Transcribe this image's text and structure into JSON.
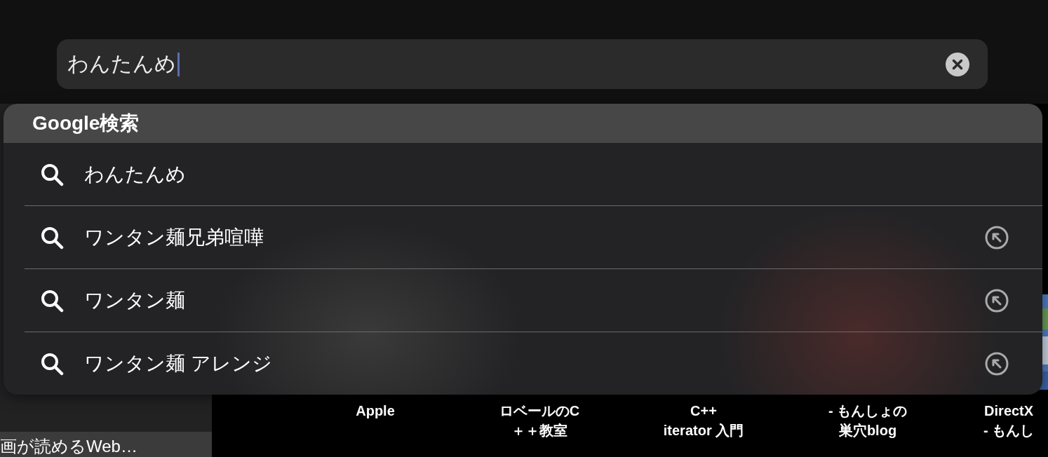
{
  "search": {
    "value": "わんたんめ"
  },
  "suggestions": {
    "title": "Google検索",
    "items": [
      {
        "text": "わんたんめ",
        "fill_button": false
      },
      {
        "text": "ワンタン麺兄弟喧嘩",
        "fill_button": true
      },
      {
        "text": "ワンタン麺",
        "fill_button": true
      },
      {
        "text": "ワンタン麺 アレンジ",
        "fill_button": true
      }
    ]
  },
  "sidebar": {
    "item": "画が読めるWeb…"
  },
  "bookmarks": [
    {
      "lines": [
        "Apple"
      ]
    },
    {
      "lines": [
        "ロベールのC",
        "＋＋教室"
      ]
    },
    {
      "lines": [
        "C++",
        "iterator 入門"
      ]
    },
    {
      "lines": [
        "- もんしょの",
        "巣穴blog"
      ]
    },
    {
      "lines": [
        "DirectX",
        "- もんし"
      ]
    }
  ]
}
